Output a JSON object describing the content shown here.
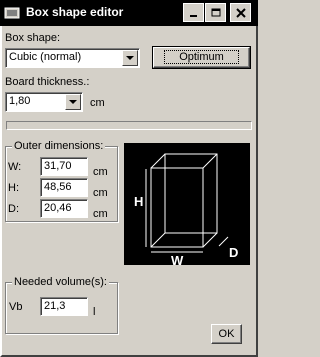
{
  "window": {
    "title": "Box shape editor"
  },
  "form": {
    "box_shape_label": "Box shape:",
    "box_shape_value": "Cubic (normal)",
    "optimum_label": "Optimum",
    "board_thickness_label": "Board thickness.:",
    "board_thickness_value": "1,80",
    "board_thickness_unit": "cm"
  },
  "progress": {
    "fraction": 0
  },
  "outer_dimensions": {
    "legend": "Outer dimensions:",
    "w_label": "W:",
    "w_value": "31,70",
    "w_unit": "cm",
    "h_label": "H:",
    "h_value": "48,56",
    "h_unit": "cm",
    "d_label": "D:",
    "d_value": "20,46",
    "d_unit": "cm"
  },
  "diagram": {
    "h_letter": "H",
    "w_letter": "W",
    "d_letter": "D"
  },
  "needed_volume": {
    "legend": "Needed volume(s):",
    "vb_label": "Vb",
    "vb_value": "21,3",
    "vb_unit": "l"
  },
  "ok_label": "OK",
  "colors": {
    "titlebar": "#000000",
    "face": "#d4d0c8"
  }
}
